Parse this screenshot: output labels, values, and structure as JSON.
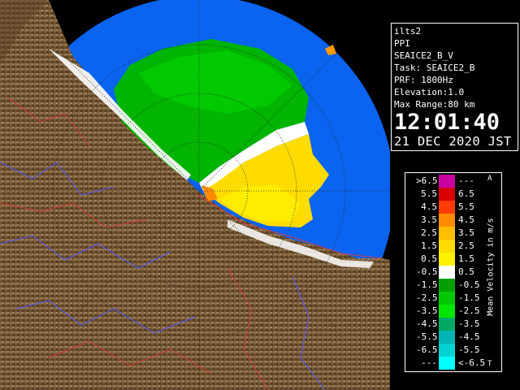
{
  "info": {
    "radar_name": "ilts2",
    "scan_type": "PPI",
    "product": "SEAICE2_B_V",
    "task": "Task: SEAICE2_B",
    "prf": "PRF: 1800Hz",
    "elevation": "Elevation:1.0",
    "max_range": "Max Range:80 km",
    "time": "12:01:40",
    "date": "21 DEC 2020 JST"
  },
  "legend": {
    "title": "Mean Velocity in m/s",
    "corner_top": "A",
    "corner_bottom": "T",
    "rows": [
      {
        "lo": ">6.5",
        "hi": "---",
        "color": "#c800a0"
      },
      {
        "lo": "5.5",
        "hi": "6.5",
        "color": "#d80000"
      },
      {
        "lo": "4.5",
        "hi": "5.5",
        "color": "#ff3c00"
      },
      {
        "lo": "3.5",
        "hi": "4.5",
        "color": "#ff8c00"
      },
      {
        "lo": "2.5",
        "hi": "3.5",
        "color": "#ffbe00"
      },
      {
        "lo": "1.5",
        "hi": "2.5",
        "color": "#ffdc00"
      },
      {
        "lo": "0.5",
        "hi": "1.5",
        "color": "#fff000"
      },
      {
        "lo": "-0.5",
        "hi": "0.5",
        "color": "#ffffff"
      },
      {
        "lo": "-1.5",
        "hi": "-0.5",
        "color": "#00a000"
      },
      {
        "lo": "-2.5",
        "hi": "-1.5",
        "color": "#00c800"
      },
      {
        "lo": "-3.5",
        "hi": "-2.5",
        "color": "#00e600"
      },
      {
        "lo": "-4.5",
        "hi": "-3.5",
        "color": "#00aa64"
      },
      {
        "lo": "-5.5",
        "hi": "-4.5",
        "color": "#00b4b4"
      },
      {
        "lo": "-6.5",
        "hi": "-5.5",
        "color": "#00d2d2"
      },
      {
        "lo": "---",
        "hi": "<-6.5",
        "color": "#00ffff"
      }
    ]
  },
  "colors": {
    "sea": "#0a64f0",
    "land": "#7a5c38",
    "range_ring": "#1a1a1a",
    "river": "#5a5aff",
    "border": "#d23c3c"
  }
}
